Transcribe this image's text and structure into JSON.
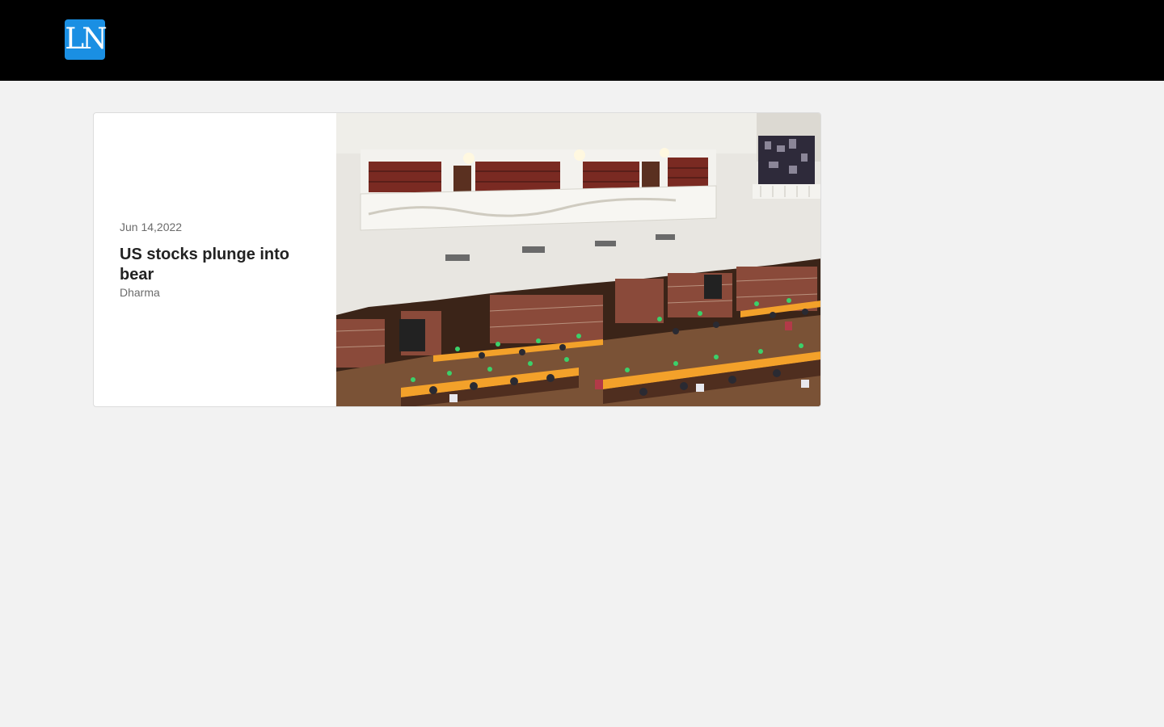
{
  "header": {
    "logo_text": "LN",
    "logo_color": "#1a8fe3",
    "background": "#000000"
  },
  "article": {
    "date": "Jun 14,2022",
    "title": "US stocks plunge into bear",
    "author": "Dharma",
    "image_icon": "library-reading-room-photo"
  }
}
